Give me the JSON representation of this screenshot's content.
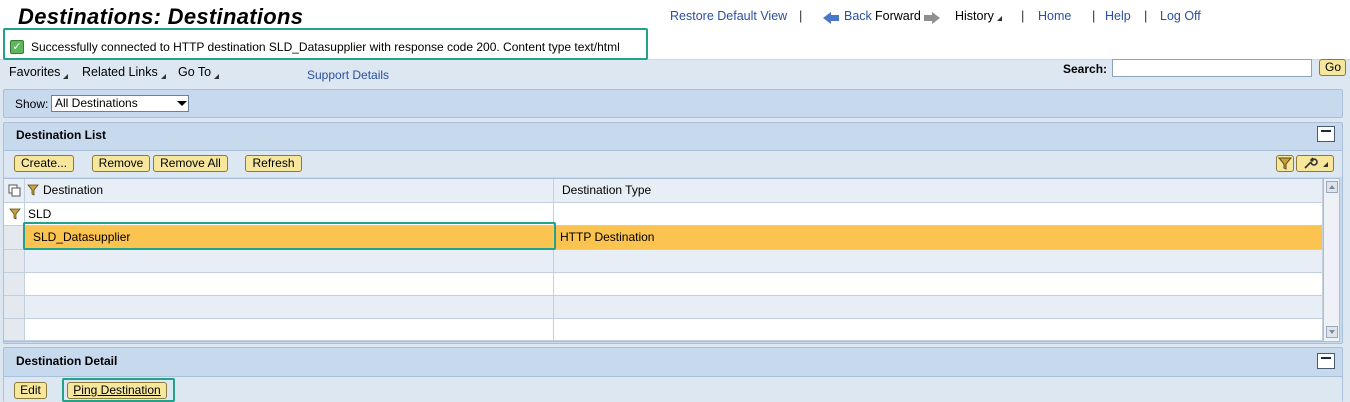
{
  "header": {
    "title": "Destinations: Destinations",
    "restore_default_view": "Restore Default View",
    "back": "Back",
    "forward": "Forward",
    "history": "History",
    "home": "Home",
    "help": "Help",
    "log_off": "Log Off",
    "separator": "|"
  },
  "message": {
    "text": "Successfully connected to HTTP destination SLD_Datasupplier with response code 200. Content type text/html",
    "status_color": "#5cb85c"
  },
  "menu": {
    "favorites": "Favorites",
    "related_links": "Related Links",
    "go_to": "Go To",
    "support_details": "Support Details",
    "search_label": "Search:",
    "search_value": "",
    "go_label": "Go"
  },
  "show": {
    "label": "Show:",
    "selected": "All Destinations"
  },
  "list_panel": {
    "title": "Destination List",
    "buttons": {
      "create": "Create...",
      "remove": "Remove",
      "remove_all": "Remove All",
      "refresh": "Refresh"
    },
    "columns": {
      "destination": "Destination",
      "type": "Destination Type"
    },
    "filter_value": "SLD",
    "rows": [
      {
        "destination": "SLD_Datasupplier",
        "type": "HTTP Destination",
        "selected": true
      }
    ],
    "selected_color": "#fbc34f"
  },
  "detail_panel": {
    "title": "Destination Detail",
    "buttons": {
      "edit": "Edit",
      "ping": "Ping Destination"
    }
  }
}
